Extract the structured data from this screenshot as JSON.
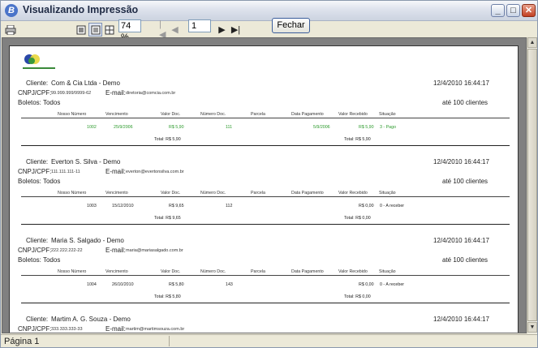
{
  "window": {
    "title": "Visualizando Impressão",
    "app_icon": "B"
  },
  "toolbar": {
    "zoom": "74 %",
    "page": "1",
    "close_label": "Fechar"
  },
  "status": {
    "page_label": "Página 1"
  },
  "report": {
    "columns": [
      "Nosso Número",
      "Vencimento",
      "Valor Doc.",
      "Número Doc.",
      "Parcela",
      "Data Pagamento",
      "Valor Recebido",
      "Situação"
    ],
    "clients": [
      {
        "cliente_label": "Cliente:",
        "name": "Com & Cia Ltda - Demo",
        "cpf_label": "CNPJ/CPF:",
        "cpf": "99.999.999/9999-62",
        "email_label": "E-mail:",
        "email": "diretoria@comcia.com.br",
        "datetime": "12/4/2010 16:44:17",
        "boletos": "Boletos: Todos",
        "limit": "até 100 clientes",
        "row": {
          "nosso": "1002",
          "venc": "25/9/2006",
          "valor": "R$ 5,90",
          "num": "111",
          "parcela": "",
          "pag": "5/9/2006",
          "receb": "R$ 5,90",
          "sit": "3 - Pago"
        },
        "total_doc": "Total: R$ 5,90",
        "total_receb": "Total: R$ 5,90",
        "green": true
      },
      {
        "cliente_label": "Cliente:",
        "name": "Everton S. Silva - Demo",
        "cpf_label": "CNPJ/CPF:",
        "cpf": "111.111.111-11",
        "email_label": "E-mail:",
        "email": "everton@evertonsilva.com.br",
        "datetime": "12/4/2010 16:44:17",
        "boletos": "Boletos: Todos",
        "limit": "até 100 clientes",
        "row": {
          "nosso": "1003",
          "venc": "15/12/2010",
          "valor": "R$ 9,65",
          "num": "112",
          "parcela": "",
          "pag": "",
          "receb": "R$ 0,00",
          "sit": "0 - A receber"
        },
        "total_doc": "Total: R$ 9,65",
        "total_receb": "Total: R$ 0,00",
        "green": false
      },
      {
        "cliente_label": "Cliente:",
        "name": "Maria S. Salgado - Demo",
        "cpf_label": "CNPJ/CPF:",
        "cpf": "222.222.222-22",
        "email_label": "E-mail:",
        "email": "maria@mariasalgado.com.br",
        "datetime": "12/4/2010 16:44:17",
        "boletos": "Boletos: Todos",
        "limit": "até 100 clientes",
        "row": {
          "nosso": "1004",
          "venc": "26/10/2010",
          "valor": "R$ 5,80",
          "num": "143",
          "parcela": "",
          "pag": "",
          "receb": "R$ 0,00",
          "sit": "0 - A receber"
        },
        "total_doc": "Total: R$ 5,80",
        "total_receb": "Total: R$ 0,00",
        "green": false
      },
      {
        "cliente_label": "Cliente:",
        "name": "Martim A. G. Souza - Demo",
        "cpf_label": "CNPJ/CPF:",
        "cpf": "333.333.333-33",
        "email_label": "E-mail:",
        "email": "martim@martimsouza.com.br",
        "datetime": "12/4/2010 16:44:17"
      }
    ]
  }
}
